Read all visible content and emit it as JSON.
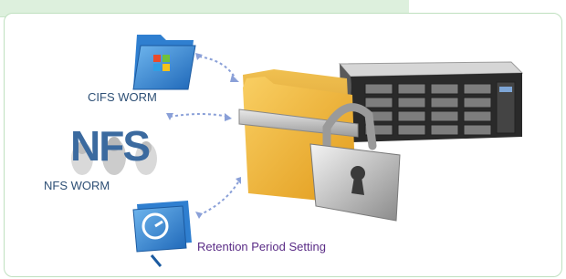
{
  "labels": {
    "cifs": "CIFS WORM",
    "nfs_logo": "NFS",
    "nfs": "NFS WORM",
    "retention": "Retention Period Setting"
  },
  "icons": {
    "cifs": "windows-folder-icon",
    "nfs": "linux-penguins-icon",
    "retention": "retention-timer-icon",
    "central": "locked-folder-icon",
    "storage": "rack-server-icon"
  },
  "colors": {
    "frame": "#bfe0bf",
    "label_blue": "#2d4f75",
    "label_purple": "#5a2c86",
    "arrow": "#8aa0d8"
  }
}
